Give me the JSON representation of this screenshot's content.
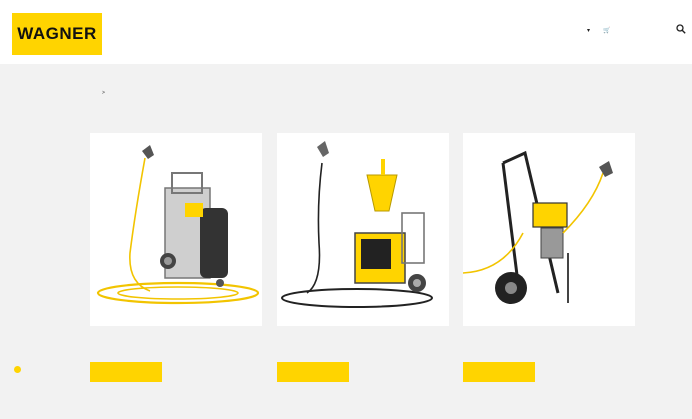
{
  "header": {
    "logo_text": "WAGNER",
    "nav": [
      {
        "label": ""
      },
      {
        "label": ""
      },
      {
        "label": ""
      },
      {
        "label": ""
      },
      {
        "label": ""
      }
    ],
    "language": "",
    "cart": ""
  },
  "breadcrumb": {
    "home": "",
    "separator": ">",
    "current": ""
  },
  "page": {
    "title": ""
  },
  "products": [
    {
      "title": "",
      "button": ""
    },
    {
      "title": "",
      "button": ""
    },
    {
      "title": "",
      "button": ""
    }
  ],
  "colors": {
    "brand_yellow": "#ffd400",
    "background": "#f2f2f2",
    "breadcrumb_active": "#2aa08a"
  }
}
